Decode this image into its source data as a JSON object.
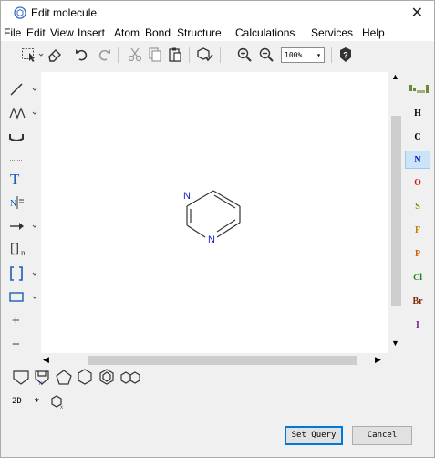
{
  "window": {
    "title": "Edit molecule",
    "close_glyph": "✕"
  },
  "menu": [
    "File",
    "Edit",
    "View",
    "Insert",
    "Atom",
    "Bond",
    "Structure",
    "Calculations",
    "Services",
    "Help"
  ],
  "toolbar": {
    "zoom_value": "100%"
  },
  "left_tools": {
    "text_label": "T",
    "rgroup_label": "[]",
    "rgroup_sub": "n",
    "plus_label": "+",
    "minus_label": "−"
  },
  "periodic": [
    {
      "symbol": "H",
      "color": "#000000"
    },
    {
      "symbol": "C",
      "color": "#000000"
    },
    {
      "symbol": "N",
      "color": "#1a1ad0"
    },
    {
      "symbol": "O",
      "color": "#d01a1a"
    },
    {
      "symbol": "S",
      "color": "#8a8a00"
    },
    {
      "symbol": "F",
      "color": "#c08000"
    },
    {
      "symbol": "P",
      "color": "#d06000"
    },
    {
      "symbol": "Cl",
      "color": "#1a8a1a"
    },
    {
      "symbol": "Br",
      "color": "#7a2a00"
    },
    {
      "symbol": "I",
      "color": "#7a1a9a"
    }
  ],
  "selected_atom": "N",
  "molecule": {
    "atom_labels": [
      "N",
      "N"
    ],
    "label_color": "#1a1ad0"
  },
  "bottom": {
    "mode_2d": "2D",
    "star": "*"
  },
  "buttons": {
    "set_query": "Set Query",
    "cancel": "Cancel"
  },
  "icons": {
    "app": "molecule-app-icon",
    "zoom_in": "zoom-in-icon",
    "zoom_out": "zoom-out-icon",
    "help": "help-icon"
  }
}
